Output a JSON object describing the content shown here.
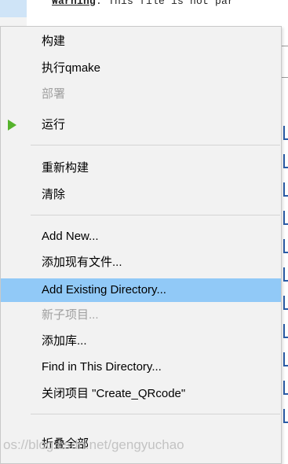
{
  "background": {
    "warning_prefix": "Warning",
    "warning_rest": ": This file is not par"
  },
  "menu": {
    "items": [
      {
        "label": "构建",
        "state": "normal"
      },
      {
        "label": "执行qmake",
        "state": "normal"
      },
      {
        "label": "部署",
        "state": "disabled"
      },
      {
        "label": "运行",
        "state": "normal",
        "icon": "run-triangle-icon"
      },
      {
        "label": "重新构建",
        "state": "normal"
      },
      {
        "label": "清除",
        "state": "normal"
      },
      {
        "label": "Add New...",
        "state": "normal"
      },
      {
        "label": "添加现有文件...",
        "state": "normal"
      },
      {
        "label": "Add Existing Directory...",
        "state": "highlighted"
      },
      {
        "label": "新子项目...",
        "state": "disabled"
      },
      {
        "label": "添加库...",
        "state": "normal"
      },
      {
        "label": "Find in This Directory...",
        "state": "normal"
      },
      {
        "label": "关闭项目 \"Create_QRcode\"",
        "state": "normal"
      },
      {
        "label": "折叠全部",
        "state": "normal"
      }
    ]
  },
  "watermark": {
    "text": "os://blog.csdn.net/gengyuchao"
  },
  "colors": {
    "highlight": "#91c9f7",
    "run_icon": "#55b32c",
    "disabled_text": "#a0a0a0"
  }
}
